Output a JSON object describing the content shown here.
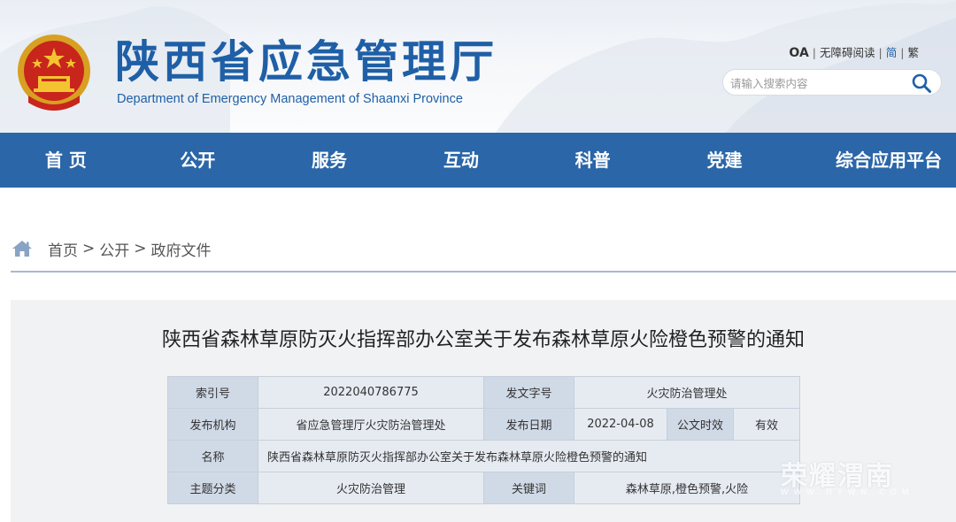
{
  "header": {
    "title_cn": "陕西省应急管理厅",
    "title_en": "Department of Emergency Management of Shaanxi Province",
    "emblem_icon": "national-emblem-icon",
    "top_links": {
      "oa": "OA",
      "accessibility": "无障碍阅读",
      "simplified": "简",
      "traditional": "繁"
    },
    "search": {
      "placeholder": "请输入搜索内容",
      "icon": "search-icon"
    }
  },
  "nav": {
    "items": [
      {
        "label": "首 页"
      },
      {
        "label": "公开"
      },
      {
        "label": "服务"
      },
      {
        "label": "互动"
      },
      {
        "label": "科普"
      },
      {
        "label": "党建"
      },
      {
        "label": "综合应用平台"
      }
    ]
  },
  "breadcrumb": {
    "icon": "home-icon",
    "items": [
      "首页",
      "公开",
      "政府文件"
    ],
    "separator": ">"
  },
  "document": {
    "title": "陕西省森林草原防灭火指挥部办公室关于发布森林草原火险橙色预警的通知",
    "info": {
      "index_label": "索引号",
      "index_value": "2022040786775",
      "doc_number_label": "发文字号",
      "doc_number_value": "火灾防治管理处",
      "issuer_label": "发布机构",
      "issuer_value": "省应急管理厅火灾防治管理处",
      "date_label": "发布日期",
      "date_value": "2022-04-08",
      "validity_label": "公文时效",
      "validity_value": "有效",
      "name_label": "名称",
      "name_value": "陕西省森林草原防灭火指挥部办公室关于发布森林草原火险橙色预警的通知",
      "topic_label": "主题分类",
      "topic_value": "火灾防治管理",
      "keywords_label": "关键词",
      "keywords_value": "森林草原,橙色预警,火险"
    }
  },
  "watermark": {
    "text": "荣耀渭南",
    "sub": "WWW.RYWN.COM"
  },
  "colors": {
    "brand_blue": "#1f5fa6",
    "nav_bg": "#2a66a8",
    "label_cell": "#d0d9e6",
    "value_cell": "#e6ebf2",
    "panel_bg": "#f1f2f4"
  }
}
